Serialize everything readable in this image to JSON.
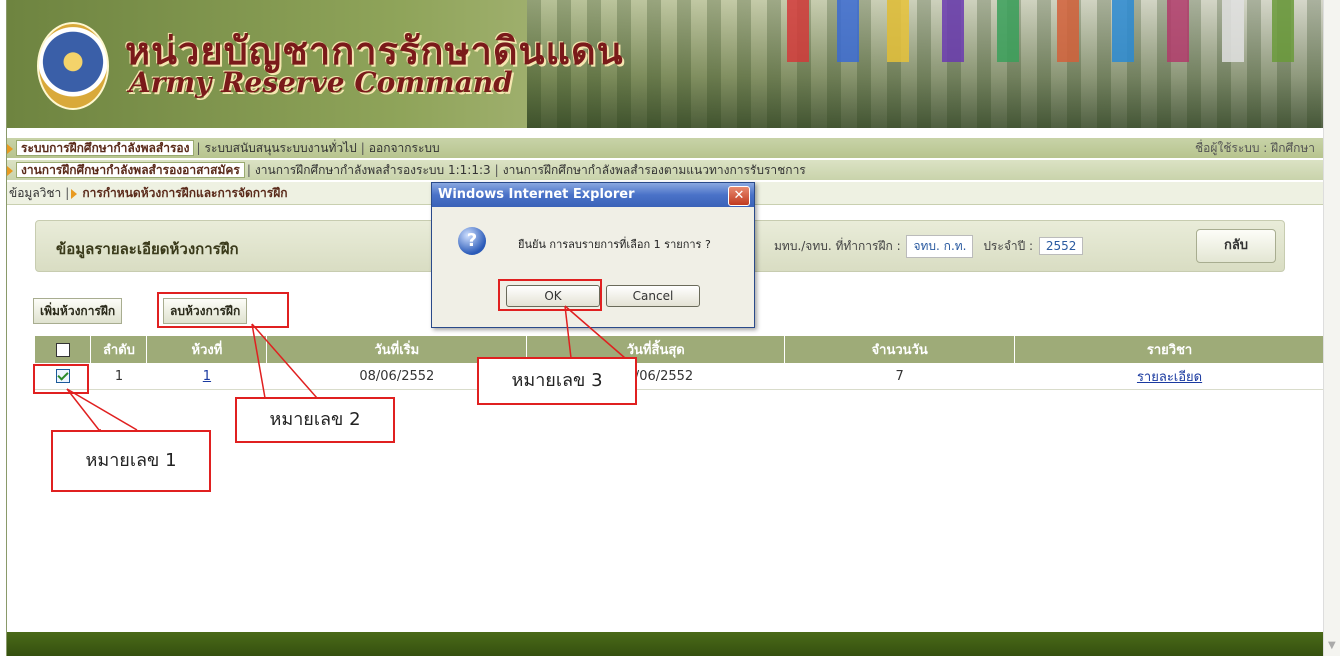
{
  "banner": {
    "title_th": "หน่วยบัญชาการรักษาดินแดน",
    "title_en": "Army Reserve Command"
  },
  "menu1": {
    "items": [
      "ระบบการฝึกศึกษากำลังพลสำรอง",
      "ระบบสนับสนุนระบบงานทั่วไป",
      "ออกจากระบบ"
    ],
    "user_label": "ชื่อผู้ใช้ระบบ : ฝึกศึกษา"
  },
  "menu2": {
    "items": [
      "งานการฝึกศึกษากำลังพลสำรองอาสาสมัคร",
      "งานการฝึกศึกษากำลังพลสำรองระบบ 1:1:1:3",
      "งานการฝึกศึกษากำลังพลสำรองตามแนวทางการรับราชการ"
    ]
  },
  "breadcrumb": {
    "items": [
      "ข้อมูลวิชา",
      "การกำหนดห้วงการฝึกและการจัดการฝึก"
    ]
  },
  "panel": {
    "title": "ข้อมูลรายละเอียดห้วงการฝึก",
    "unit_label": "มทบ./จทบ. ที่ทำการฝึก :",
    "unit_value": "จทบ. ก.ท.",
    "year_label": "ประจำปี :",
    "year_value": "2552",
    "back_label": "กลับ"
  },
  "actions": {
    "add_label": "เพิ่มห้วงการฝึก",
    "delete_label": "ลบห้วงการฝึก"
  },
  "table": {
    "headers": [
      "",
      "ลำดับ",
      "ห้วงที่",
      "วันที่เริ่ม",
      "วันที่สิ้นสุด",
      "จำนวนวัน",
      "รายวิชา"
    ],
    "rows": [
      {
        "checked": true,
        "index": "1",
        "period": "1",
        "start": "08/06/2552",
        "end": "15/06/2552",
        "days": "7",
        "subject": "รายละเอียด"
      }
    ]
  },
  "dialog": {
    "title": "Windows Internet Explorer",
    "close": "✕",
    "icon": "?",
    "message": "ยืนยัน การลบรายการที่เลือก 1 รายการ ?",
    "ok_label": "OK",
    "cancel_label": "Cancel"
  },
  "callouts": {
    "c1": "หมายเลข 1",
    "c2": "หมายเลข 2",
    "c3": "หมายเลข 3"
  },
  "colors": {
    "accent_red": "#e02020",
    "header_green": "#9eab78",
    "footer_green": "#3a5512"
  }
}
